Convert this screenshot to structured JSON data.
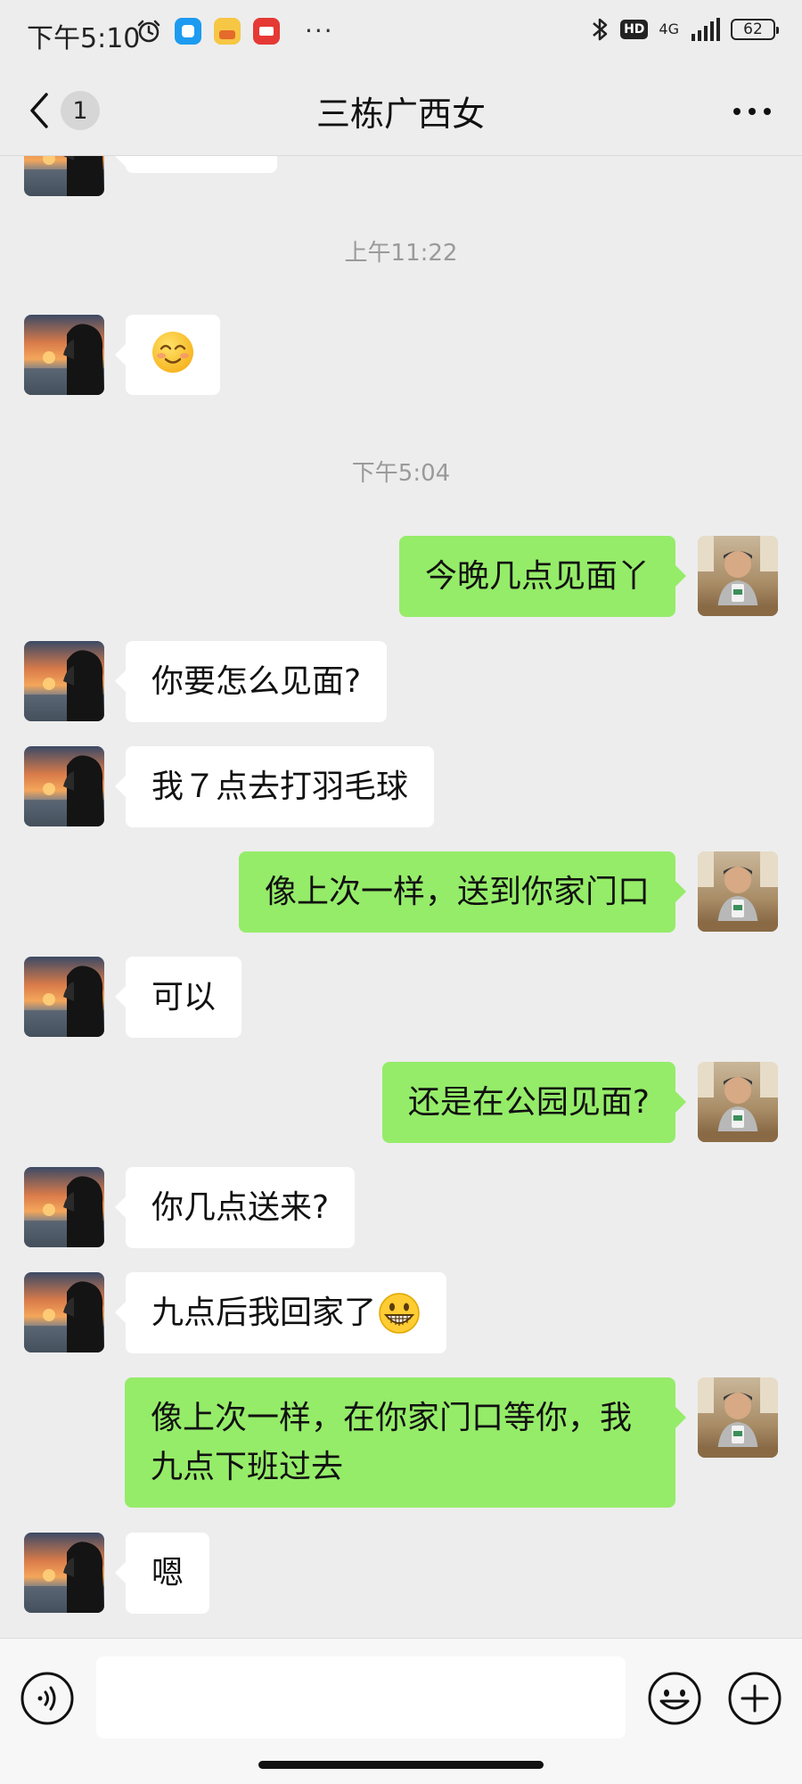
{
  "status_bar": {
    "time": "下午5:10",
    "more": "···",
    "network": "4G",
    "hd": "HD",
    "battery": "62"
  },
  "header": {
    "title": "三栋广西女",
    "unread_count": "1"
  },
  "messages": [
    {
      "type": "timestamp",
      "text": "上午11:22"
    },
    {
      "type": "emoji",
      "side": "left",
      "emoji": "smiling-face-icon"
    },
    {
      "type": "timestamp",
      "text": "下午5:04"
    },
    {
      "type": "text",
      "side": "right",
      "text": "今晚几点见面丫"
    },
    {
      "type": "text",
      "side": "left",
      "text": "你要怎么见面?"
    },
    {
      "type": "text",
      "side": "left",
      "text": "我７点去打羽毛球"
    },
    {
      "type": "text",
      "side": "right",
      "text": "像上次一样，送到你家门口"
    },
    {
      "type": "text",
      "side": "left",
      "text": "可以"
    },
    {
      "type": "text",
      "side": "right",
      "text": "还是在公园见面?"
    },
    {
      "type": "text",
      "side": "left",
      "text": "你几点送来?"
    },
    {
      "type": "text",
      "side": "left",
      "text": "九点后我回家了",
      "emoji": "grinning-face-icon"
    },
    {
      "type": "text",
      "side": "right",
      "text": "像上次一样，在你家门口等你，我九点下班过去"
    },
    {
      "type": "text",
      "side": "left",
      "text": "嗯"
    }
  ],
  "input": {
    "value": "",
    "placeholder": ""
  },
  "colors": {
    "background": "#EDEDED",
    "incoming_bubble": "#FFFFFF",
    "outgoing_bubble": "#95EC69",
    "timestamp": "#9A9A9A"
  }
}
